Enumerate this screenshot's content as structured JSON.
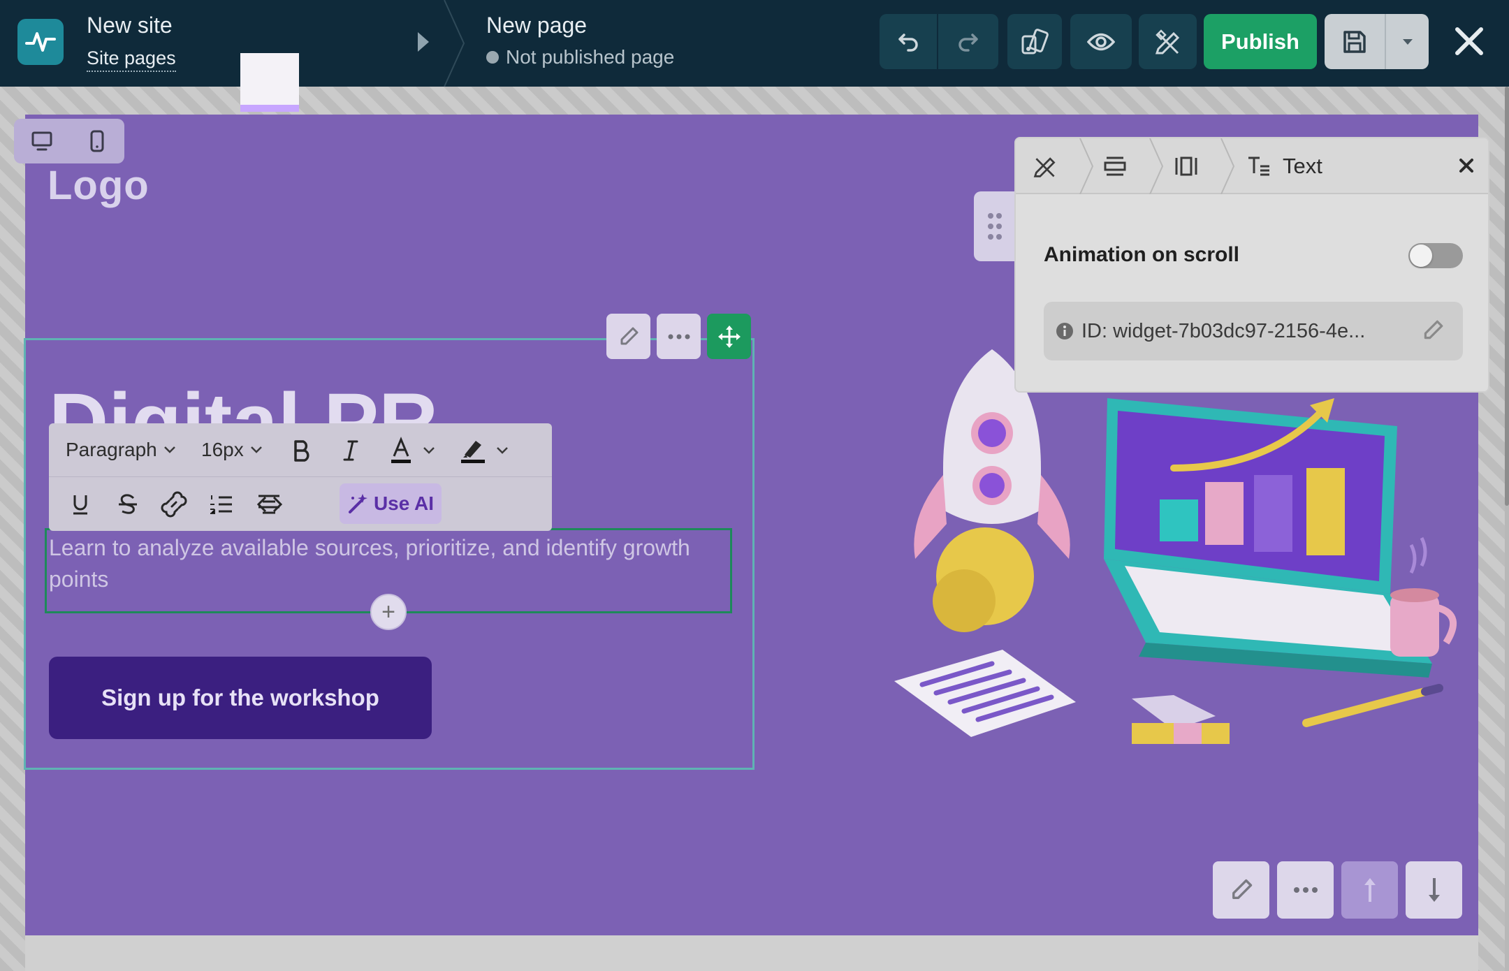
{
  "topbar": {
    "site_name": "New site",
    "site_pages_link": "Site pages",
    "page_name": "New page",
    "page_status": "Not published page",
    "publish_label": "Publish"
  },
  "canvas": {
    "logo_text": "Logo",
    "heading": "Digital PR",
    "subtitle": "Learn to analyze available sources, prioritize, and identify growth points",
    "cta_label": "Sign up for the workshop",
    "add_block_symbol": "+"
  },
  "format_toolbar": {
    "block_type": "Paragraph",
    "font_size": "16px",
    "use_ai_label": "Use AI"
  },
  "settings_panel": {
    "tab_title": "Text",
    "animation_label": "Animation on scroll",
    "animation_enabled": false,
    "widget_id_text": "ID: widget-7b03dc97-2156-4e..."
  },
  "colors": {
    "topbar_bg": "#0f2a3a",
    "publish_green": "#1ca065",
    "hero_purple": "#7c61b4",
    "cta_dark_purple": "#3b1f80",
    "selection_teal": "#5fb3b3"
  }
}
